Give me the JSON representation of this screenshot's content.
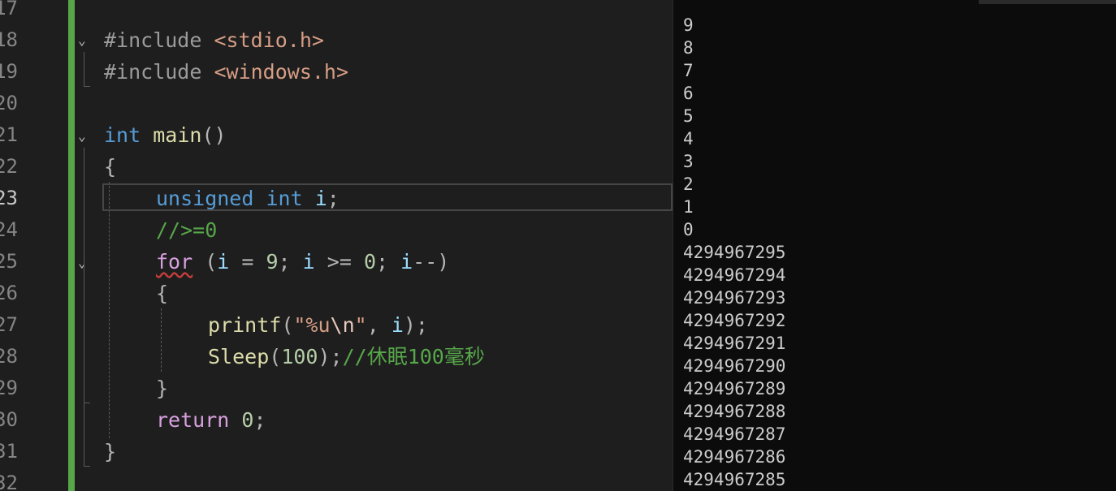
{
  "editor": {
    "line_numbers": [
      "17",
      "18",
      "19",
      "20",
      "21",
      "22",
      "23",
      "24",
      "25",
      "26",
      "27",
      "28",
      "29",
      "30",
      "31",
      "32"
    ],
    "lines": {
      "l18": {
        "directive": "#include ",
        "header": "<stdio.h>"
      },
      "l19": {
        "directive": "#include ",
        "header": "<windows.h>"
      },
      "l21": {
        "type": "int",
        "space": " ",
        "name": "main",
        "parens": "()"
      },
      "l22": {
        "brace": "{"
      },
      "l23": {
        "type": "unsigned int",
        "space": " ",
        "var": "i",
        "semi": ";"
      },
      "l24": {
        "comment": "//>=0"
      },
      "l25": {
        "kw": "for",
        "p1": " (",
        "v1": "i",
        "op1": " = ",
        "n1": "9",
        "s1": "; ",
        "v2": "i",
        "op2": " >= ",
        "n2": "0",
        "s2": "; ",
        "v3": "i",
        "op3": "--)"
      },
      "l26": {
        "brace": "{"
      },
      "l27": {
        "fn": "printf",
        "p1": "(",
        "q1": "\"%u",
        "esc": "\\n",
        "q2": "\"",
        "p2": ", ",
        "v": "i",
        "p3": ");"
      },
      "l28": {
        "fn": "Sleep",
        "p1": "(",
        "n": "100",
        "p2": ");",
        "comment": "//休眠100毫秒"
      },
      "l29": {
        "brace": "}"
      },
      "l30": {
        "kw": "return",
        "space": " ",
        "n": "0",
        "semi": ";"
      },
      "l31": {
        "brace": "}"
      }
    }
  },
  "console": {
    "output": [
      "9",
      "8",
      "7",
      "6",
      "5",
      "4",
      "3",
      "2",
      "1",
      "0",
      "4294967295",
      "4294967294",
      "4294967293",
      "4294967292",
      "4294967291",
      "4294967290",
      "4294967289",
      "4294967288",
      "4294967287",
      "4294967286",
      "4294967285"
    ]
  },
  "colors": {
    "editor_bg": "#1e1e1e",
    "console_bg": "#0c0c0c",
    "keyword": "#569cd6",
    "control_keyword": "#d8a0df",
    "function": "#dcdcaa",
    "comment": "#57a64a",
    "string": "#d69d85",
    "number": "#b5cea8",
    "changed_bar": "#57a64a"
  }
}
